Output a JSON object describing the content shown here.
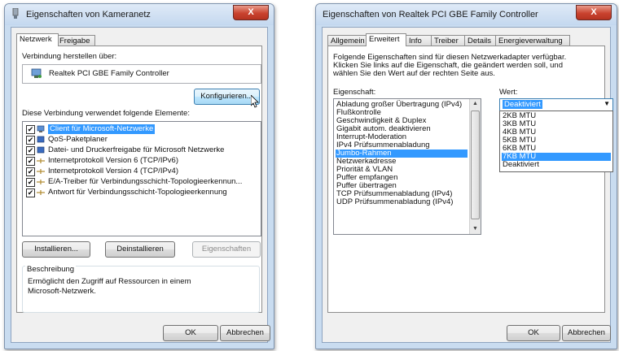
{
  "dialog_left": {
    "title": "Eigenschaften von Kameranetz",
    "close": "X",
    "tabs": [
      "Netzwerk",
      "Freigabe"
    ],
    "connect_via_label": "Verbindung herstellen über:",
    "adapter_name": "Realtek PCI GBE Family Controller",
    "configure_button": "Konfigurieren...",
    "elements_label": "Diese Verbindung verwendet folgende Elemente:",
    "items": [
      {
        "label": "Client für Microsoft-Netzwerke",
        "checked": true,
        "selected": true
      },
      {
        "label": "QoS-Paketplaner",
        "checked": true
      },
      {
        "label": "Datei- und Druckerfreigabe für Microsoft Netzwerke",
        "checked": true
      },
      {
        "label": "Internetprotokoll Version 6 (TCP/IPv6)",
        "checked": true
      },
      {
        "label": "Internetprotokoll Version 4 (TCP/IPv4)",
        "checked": true
      },
      {
        "label": "E/A-Treiber für Verbindungsschicht-Topologieerkennun...",
        "checked": true
      },
      {
        "label": "Antwort für Verbindungsschicht-Topologieerkennung",
        "checked": true
      }
    ],
    "install_button": "Installieren...",
    "uninstall_button": "Deinstallieren",
    "properties_button": "Eigenschaften",
    "description_label": "Beschreibung",
    "description_text": [
      "Ermöglicht den Zugriff auf Ressourcen in einem",
      "Microsoft-Netzwerk."
    ],
    "ok_button": "OK",
    "cancel_button": "Abbrechen"
  },
  "dialog_right": {
    "title": "Eigenschaften von Realtek PCI GBE Family Controller",
    "close": "X",
    "tabs": [
      "Allgemein",
      "Erweitert",
      "Info",
      "Treiber",
      "Details",
      "Energieverwaltung"
    ],
    "intro": [
      "Folgende Eigenschaften sind für diesen Netzwerkadapter verfügbar.",
      "Klicken Sie links auf die Eigenschaft, die geändert werden soll, und",
      "wählen Sie den Wert auf der rechten Seite aus."
    ],
    "property_label": "Eigenschaft:",
    "value_label": "Wert:",
    "properties": [
      "Abladung großer Übertragung (IPv4)",
      "Flußkontrolle",
      "Geschwindigkeit & Duplex",
      "Gigabit autom. deaktivieren",
      "Interrupt-Moderation",
      "IPv4 Prüfsummenabladung",
      "Jumbo-Rahmen",
      "Netzwerkadresse",
      "Priorität & VLAN",
      "Puffer empfangen",
      "Puffer übertragen",
      "TCP Prüfsummenabladung (IPv4)",
      "UDP Prüfsummenabladung (IPv4)"
    ],
    "selected_property": "Jumbo-Rahmen",
    "value_selected": "Deaktiviert",
    "value_options": [
      "2KB MTU",
      "3KB MTU",
      "4KB MTU",
      "5KB MTU",
      "6KB MTU",
      "7KB MTU",
      "Deaktiviert"
    ],
    "highlighted_option": "7KB MTU",
    "ok_button": "OK",
    "cancel_button": "Abbrechen"
  },
  "colors": {
    "selection": "#3399ff",
    "titlebar": "#c4d8ef",
    "close": "#c9432f"
  }
}
